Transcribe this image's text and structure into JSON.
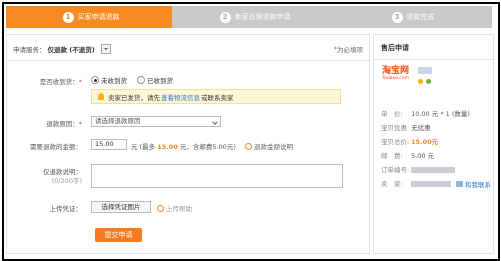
{
  "steps": [
    {
      "num": "1",
      "label": "买家申请退款"
    },
    {
      "num": "2",
      "label": "卖家处理退款申请"
    },
    {
      "num": "3",
      "label": "退款完成"
    }
  ],
  "service": {
    "label": "申请服务：",
    "value": "仅退款 (不退货)",
    "help": "为必填项"
  },
  "form": {
    "received_label": "是否收到货：",
    "received_options": [
      "未收到货",
      "已收到货"
    ],
    "tip_prefix": "卖家已发货，请先",
    "tip_link": "查看物流信息",
    "tip_suffix": "或联系卖家",
    "reason_label": "退款原因：",
    "reason_placeholder": "请选择退款原因",
    "amount_label": "需要退款的金额：",
    "amount_value": "15.00",
    "amount_unit": "元",
    "amount_note_prefix": "(最多",
    "amount_note_max": "15.00",
    "amount_note_suffix": "元，含邮费5.00元)",
    "amount_link": "退款金额说明",
    "desc_label": "仅退款说明：",
    "desc_counter": "(0/200字)",
    "upload_label": "上传凭证：",
    "upload_button": "选择凭证图片",
    "upload_help": "上传帮助",
    "submit": "提交申请",
    "required_mark": "*"
  },
  "side": {
    "title": "售后申请",
    "logo_text": "淘宝网",
    "logo_sub": "Taobao.com",
    "rows": [
      {
        "k": "单　价:",
        "v": "10.00 元 * 1 (数量)"
      },
      {
        "k": "宝贝优惠:",
        "v": "无优惠"
      },
      {
        "k": "宝贝总价:",
        "v": "15.00元"
      },
      {
        "k": "邮　费:",
        "v": "5.00 元"
      },
      {
        "k": "订单编号:",
        "v": ""
      },
      {
        "k": "卖　家:",
        "v": ""
      }
    ],
    "contact": "和我联系"
  },
  "colors": {
    "accent": "#f58a22",
    "link": "#2a7ac4",
    "inactive_step": "#c9c9c9"
  }
}
